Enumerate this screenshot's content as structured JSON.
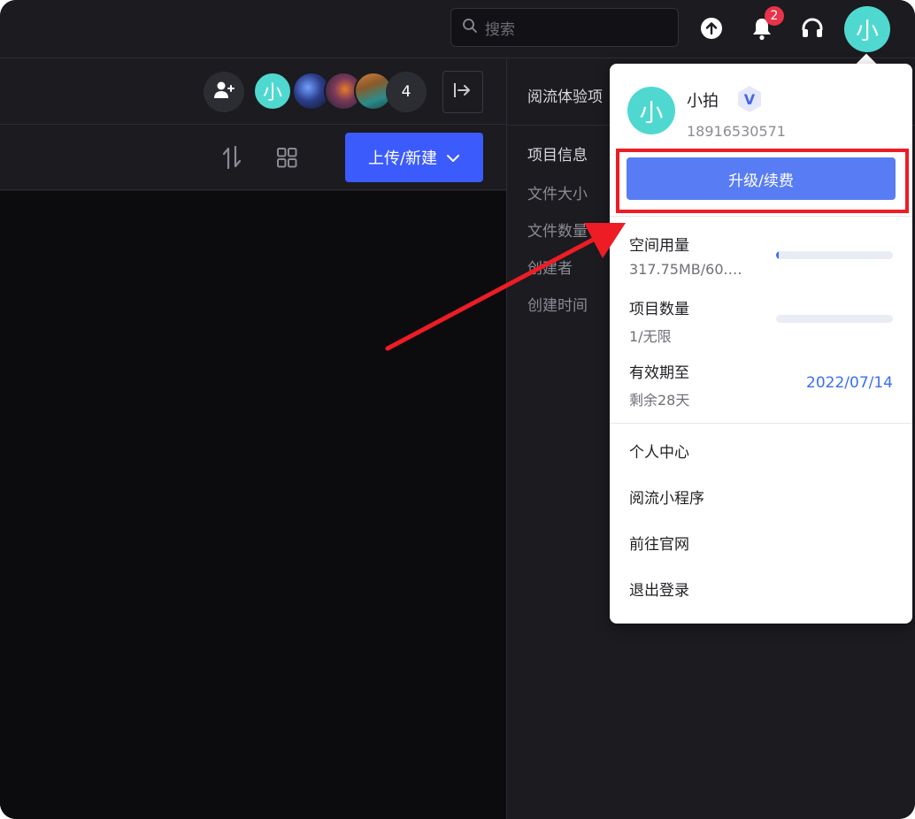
{
  "topbar": {
    "search_placeholder": "搜索",
    "notification_count": "2",
    "avatar_char": "小"
  },
  "toolbar": {
    "member_avatar_char": "小",
    "member_count": "4",
    "upload_label": "上传/新建"
  },
  "panel": {
    "title": "阅流体验项",
    "section": "项目信息",
    "labels": [
      "文件大小",
      "文件数量",
      "创建者",
      "创建时间"
    ]
  },
  "dropdown": {
    "avatar_char": "小",
    "name": "小拍",
    "vip_badge": "V",
    "phone": "18916530571",
    "upgrade_label": "升级/续费",
    "storage_label": "空间用量",
    "storage_value": "317.75MB/60.…",
    "storage_fraction": 0.01,
    "projects_label": "项目数量",
    "projects_value": "1/无限",
    "projects_fraction": 0.0,
    "expire_label": "有效期至",
    "expire_remaining": "剩余28天",
    "expire_date": "2022/07/14",
    "menu": [
      "个人中心",
      "阅流小程序",
      "前往官网",
      "退出登录"
    ]
  },
  "colors": {
    "accent": "#3b5bfd",
    "upgrade": "#587cf3",
    "avatar": "#4fd8d0",
    "badge": "#e8334a",
    "highlight": "#ee1c25",
    "link": "#3b6df6"
  }
}
